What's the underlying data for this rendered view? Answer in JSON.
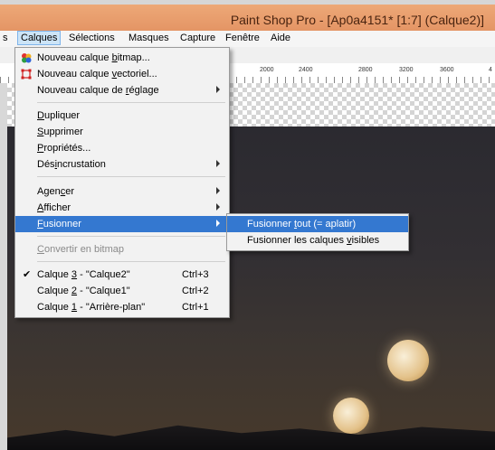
{
  "window": {
    "title": "Paint Shop Pro - [Ap0a4151* [1:7] (Calque2)]"
  },
  "menubar": {
    "items": [
      "s",
      "Calques",
      "Sélections",
      "Masques",
      "Capture",
      "Fenêtre",
      "Aide"
    ]
  },
  "ruler": {
    "labels": [
      "2000",
      "2400",
      "2800",
      "3200",
      "3600",
      "4"
    ]
  },
  "calques_menu": {
    "new_bitmap": {
      "pre": "Nouveau calque ",
      "ul": "b",
      "post": "itmap..."
    },
    "new_vector": {
      "pre": "Nouveau calque ",
      "ul": "v",
      "post": "ectoriel..."
    },
    "new_adjust": {
      "pre": "Nouveau calque de ",
      "ul": "r",
      "post": "églage"
    },
    "duplicate": {
      "pre": "",
      "ul": "D",
      "post": "upliquer"
    },
    "delete": {
      "pre": "",
      "ul": "S",
      "post": "upprimer"
    },
    "properties": {
      "pre": "",
      "ul": "P",
      "post": "ropriétés..."
    },
    "deinterlace": {
      "pre": "Dés",
      "ul": "i",
      "post": "ncrustation"
    },
    "arrange": {
      "pre": "Agen",
      "ul": "c",
      "post": "er"
    },
    "show": {
      "pre": "",
      "ul": "A",
      "post": "fficher"
    },
    "merge": {
      "pre": "",
      "ul": "F",
      "post": "usionner"
    },
    "convert": {
      "pre": "",
      "ul": "C",
      "post": "onvertir en bitmap"
    },
    "layers": [
      {
        "pre": "Calque ",
        "ul": "3",
        "post": " - \"Calque2\"",
        "shortcut": "Ctrl+3",
        "checked": true
      },
      {
        "pre": "Calque ",
        "ul": "2",
        "post": " - \"Calque1\"",
        "shortcut": "Ctrl+2",
        "checked": false
      },
      {
        "pre": "Calque ",
        "ul": "1",
        "post": " - \"Arrière-plan\"",
        "shortcut": "Ctrl+1",
        "checked": false
      }
    ],
    "checkmark": "✔"
  },
  "merge_submenu": {
    "merge_all": {
      "pre": "Fusionner ",
      "ul": "t",
      "post": "out (= aplatir)"
    },
    "merge_visible": {
      "pre": "Fusionner les calques ",
      "ul": "v",
      "post": "isibles"
    }
  },
  "icons": {
    "bitmap": "color-dots-icon",
    "vector": "vector-square-icon"
  },
  "colors": {
    "highlight": "#3478d0",
    "titlebar": "#e49565"
  }
}
